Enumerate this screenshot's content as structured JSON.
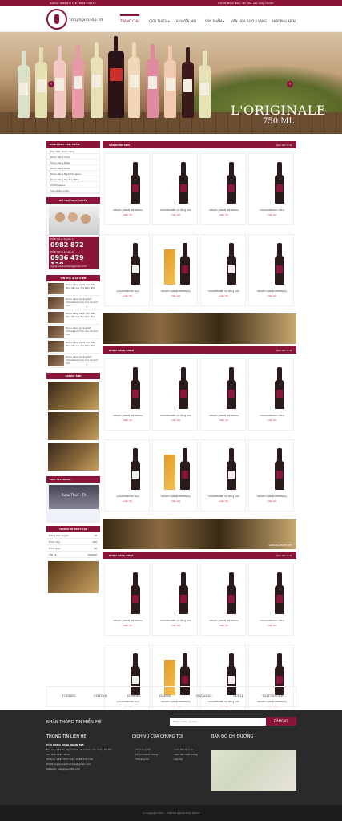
{
  "topbar": {
    "hotline": "Hotline: 0982 872 718 - 0936 479 138",
    "address": "132 Hồ Phạm Nam, Yên Hòa, Cầu Giấy, Hà Nội"
  },
  "logo": {
    "text": "Vangngon365.vn"
  },
  "nav": [
    {
      "label": "TRANG CHỦ",
      "active": true
    },
    {
      "label": "GIỚI THIỆU ▾",
      "active": false
    },
    {
      "label": "KHUYẾN MẠI",
      "active": false
    },
    {
      "label": "SẢN PHẨM ▾",
      "active": false
    },
    {
      "label": "VĂN HÓA RƯỢU VANG",
      "active": false
    },
    {
      "label": "HỘP PHỤ KIỆN",
      "active": false
    }
  ],
  "banner": {
    "title": "L'ORIGINALE",
    "subtitle": "750 ML"
  },
  "sidebar": {
    "categories_title": "DANH MỤC SẢN PHẨM",
    "categories": [
      "Phụ Kiện Rượu Vang",
      "Rượu Vang Chile",
      "Rượu Vang Pháp",
      "Rượu Vang Italia",
      "Rượu Vang Ngọt Hungary",
      "Rượu Vang Tây Ban Nha",
      "Champagne",
      "Sản phẩm khác"
    ],
    "support_title": "HỖ TRỢ TRỰC TUYẾN",
    "support_1_label": "Hỗ trợ trực tuyến 1",
    "support_1_phone": "0982 872 718",
    "support_2_label": "Hỗ trợ trực tuyến 2",
    "support_2_phone": "0936 479 138",
    "support_email": "ngoprivanhophep@gmail.com",
    "news_title": "TIN TỨC & SỰ KIỆN",
    "news": [
      "Rượu vang sanh độc đáo đầu tiên tại Tây Ban Nha",
      "Rượu vang giúp giảm cholesterol hơn tỏa và phố mai",
      "Rượu vang sanh độc đáo đầu tiên tại Tây Ban Nha",
      "Rượu vang giúp giảm cholesterol hơn tỏa và phố mai",
      "Rượu vang sanh độc đáo đầu tiên tại Tây Ban Nha",
      "Rượu vang giúp giảm cholesterol hơn tỏa và phố mai"
    ],
    "album_title": "ALBUM ẢNH",
    "facebook_title": "LIKE FACEBOOK",
    "facebook_page": "Rượu Thuế - Th",
    "stats_title": "THỐNG KÊ TRUY CẬP",
    "stats": [
      {
        "label": "Đang trực tuyến:",
        "value": "18"
      },
      {
        "label": "Hôm nay:",
        "value": "106"
      },
      {
        "label": "Hôm qua:",
        "value": "46"
      },
      {
        "label": "Tất cả:",
        "value": "200006"
      }
    ]
  },
  "sections": [
    {
      "title": "SẢN PHẨM MỚI",
      "more": "Xem tất cả ⊕",
      "products": [
        {
          "name": "APALTA (GRAN RESERVA)",
          "price": "Liên hệ",
          "kind": "red"
        },
        {
          "name": "CHAMPAGNE 10 đồng tiền",
          "price": "Liên hệ",
          "kind": "red"
        },
        {
          "name": "APALTA (GRAN RESERVA)",
          "price": "Liên hệ",
          "kind": "red"
        },
        {
          "name": "CASADONOSO 1810",
          "price": "Liên hệ",
          "kind": "red"
        },
        {
          "name": "CASADONOSO Red",
          "price": "Liên hệ",
          "kind": "white"
        },
        {
          "name": "APALTA (GRAN RESERVA)",
          "price": "Liên hệ",
          "kind": "box"
        },
        {
          "name": "CHAMPAGNE 10 đồng tiền",
          "price": "Liên hệ",
          "kind": "white"
        },
        {
          "name": "APALTA (GRAN RESERVA)",
          "price": "Liên hệ",
          "kind": "red"
        }
      ]
    },
    {
      "title": "RƯỢU VANG CHILE",
      "more": "Xem tất cả ⊕",
      "products": [
        {
          "name": "APALTA (GRAN RESERVA)",
          "price": "Liên hệ",
          "kind": "red"
        },
        {
          "name": "CHAMPAGNE 10 đồng tiền",
          "price": "Liên hệ",
          "kind": "red"
        },
        {
          "name": "APALTA (GRAN RESERVA)",
          "price": "Liên hệ",
          "kind": "red"
        },
        {
          "name": "CASADONOSO 1810",
          "price": "Liên hệ",
          "kind": "red"
        },
        {
          "name": "CASADONOSO Red",
          "price": "Liên hệ",
          "kind": "white"
        },
        {
          "name": "APALTA (GRAN RESERVA)",
          "price": "Liên hệ",
          "kind": "box"
        },
        {
          "name": "CHAMPAGNE 10 đồng tiền",
          "price": "Liên hệ",
          "kind": "white"
        },
        {
          "name": "APALTA (GRAN RESERVA)",
          "price": "Liên hệ",
          "kind": "red"
        }
      ]
    },
    {
      "title": "RƯỢU VANG PHÁP",
      "more": "Xem tất cả ⊕",
      "products": [
        {
          "name": "APALTA (GRAN RESERVA)",
          "price": "Liên hệ",
          "kind": "red"
        },
        {
          "name": "CHAMPAGNE 10 đồng tiền",
          "price": "Liên hệ",
          "kind": "red"
        },
        {
          "name": "APALTA (GRAN RESERVA)",
          "price": "Liên hệ",
          "kind": "red"
        },
        {
          "name": "CASADONOSO 1810",
          "price": "Liên hệ",
          "kind": "red"
        },
        {
          "name": "CASADONOSO Red",
          "price": "Liên hệ",
          "kind": "white"
        },
        {
          "name": "APALTA (GRAN RESERVA)",
          "price": "Liên hệ",
          "kind": "box"
        },
        {
          "name": "CHAMPAGNE 10 đồng tiền",
          "price": "Liên hệ",
          "kind": "white"
        },
        {
          "name": "APALTA (GRAN RESERVA)",
          "price": "Liên hệ",
          "kind": "red"
        }
      ]
    }
  ],
  "mid_banner_caption": "VANGNGON365.VN",
  "brands": [
    "TORRES",
    "CHIVAS",
    "HIROKI",
    "RABBS",
    "RAVANAL",
    "SPELL",
    "TAITTINGER"
  ],
  "footer": {
    "newsletter_title": "NHẬN THÔNG TIN MIỄN PHÍ",
    "email_placeholder": "Nhập email của bạn...",
    "subscribe_label": "ĐĂNG KÝ",
    "contact_title": "THÔNG TIN LIÊN HỆ",
    "shop_name": "CỬA HÀNG VANG NGON 365",
    "contact_lines": [
      "Địa chỉ: 132 Hồ Phạm Nam, Yên Hòa, Cầu Giấy, Hà Nội",
      "Tel: 024 3399 1010",
      "Hotline: 0982 872 718 - 0936 479 138",
      "Email: ngoprivanhophep@gmail.com",
      "Website: vangngon365.com"
    ],
    "services_title": "DỊCH VỤ CỦA CHÚNG TÔI",
    "services_left": [
      "Về chúng tôi",
      "Hỗ trợ khách hàng",
      "Thanh toán"
    ],
    "services_right": [
      "Cam kết dịch vụ",
      "Cam kết chất lượng",
      "Liên hệ"
    ],
    "map_title": "BẢN ĐỒ CHỈ ĐƯỜNG",
    "copyright": "© Copyright 2017 . Thiết kế & phát triển bởi ICI"
  }
}
